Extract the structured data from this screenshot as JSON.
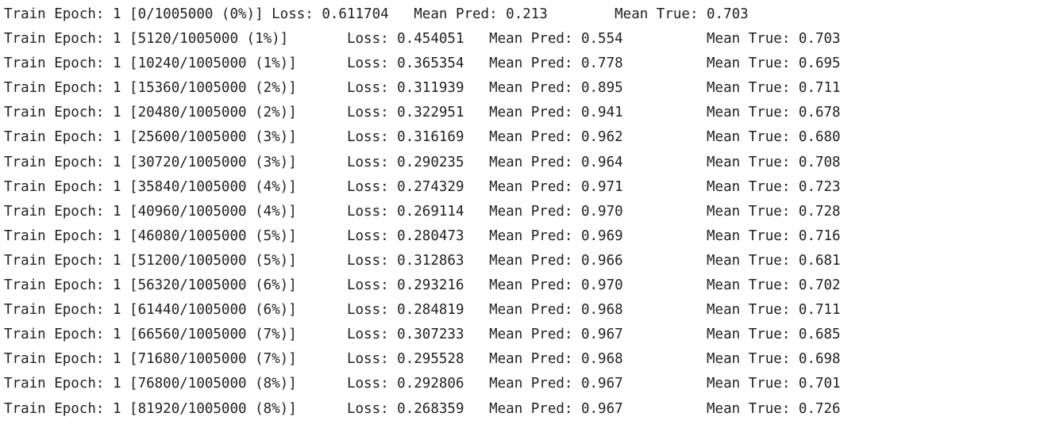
{
  "console": {
    "lines": [
      "Train Epoch: 1 [0/1005000 (0%)] Loss: 0.611704   Mean Pred: 0.213        Mean True: 0.703",
      "Train Epoch: 1 [5120/1005000 (1%)]       Loss: 0.454051   Mean Pred: 0.554          Mean True: 0.703",
      "Train Epoch: 1 [10240/1005000 (1%)]      Loss: 0.365354   Mean Pred: 0.778          Mean True: 0.695",
      "Train Epoch: 1 [15360/1005000 (2%)]      Loss: 0.311939   Mean Pred: 0.895          Mean True: 0.711",
      "Train Epoch: 1 [20480/1005000 (2%)]      Loss: 0.322951   Mean Pred: 0.941          Mean True: 0.678",
      "Train Epoch: 1 [25600/1005000 (3%)]      Loss: 0.316169   Mean Pred: 0.962          Mean True: 0.680",
      "Train Epoch: 1 [30720/1005000 (3%)]      Loss: 0.290235   Mean Pred: 0.964          Mean True: 0.708",
      "Train Epoch: 1 [35840/1005000 (4%)]      Loss: 0.274329   Mean Pred: 0.971          Mean True: 0.723",
      "Train Epoch: 1 [40960/1005000 (4%)]      Loss: 0.269114   Mean Pred: 0.970          Mean True: 0.728",
      "Train Epoch: 1 [46080/1005000 (5%)]      Loss: 0.280473   Mean Pred: 0.969          Mean True: 0.716",
      "Train Epoch: 1 [51200/1005000 (5%)]      Loss: 0.312863   Mean Pred: 0.966          Mean True: 0.681",
      "Train Epoch: 1 [56320/1005000 (6%)]      Loss: 0.293216   Mean Pred: 0.970          Mean True: 0.702",
      "Train Epoch: 1 [61440/1005000 (6%)]      Loss: 0.284819   Mean Pred: 0.968          Mean True: 0.711",
      "Train Epoch: 1 [66560/1005000 (7%)]      Loss: 0.307233   Mean Pred: 0.967          Mean True: 0.685",
      "Train Epoch: 1 [71680/1005000 (7%)]      Loss: 0.295528   Mean Pred: 0.968          Mean True: 0.698",
      "Train Epoch: 1 [76800/1005000 (8%)]      Loss: 0.292806   Mean Pred: 0.967          Mean True: 0.701",
      "Train Epoch: 1 [81920/1005000 (8%)]      Loss: 0.268359   Mean Pred: 0.967          Mean True: 0.726"
    ]
  }
}
